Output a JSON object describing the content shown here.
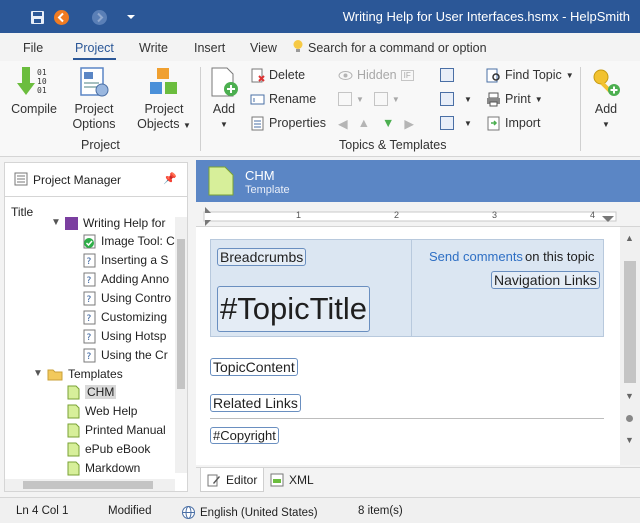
{
  "window": {
    "title": "Writing Help for User Interfaces.hsmx - HelpSmith"
  },
  "ribbon_tabs": [
    "File",
    "Project",
    "Write",
    "Insert",
    "View"
  ],
  "search": {
    "placeholder": "Search for a command or option"
  },
  "ribbon": {
    "project_group": {
      "label": "Project",
      "compile": "Compile",
      "project_options": [
        "Project",
        "Options"
      ],
      "project_objects": [
        "Project",
        "Objects"
      ]
    },
    "topics_group": {
      "label": "Topics & Templates",
      "add": "Add",
      "delete": "Delete",
      "rename": "Rename",
      "properties": "Properties",
      "hidden": "Hidden",
      "find_topic": "Find Topic",
      "print": "Print",
      "import": "Import"
    },
    "add2": "Add"
  },
  "project_manager": {
    "title": "Project Manager",
    "column": "Title",
    "topics": [
      "Writing Help for",
      "Image Tool: C",
      "Inserting a S",
      "Adding Anno",
      "Using Contro",
      "Customizing",
      "Using Hotsp",
      "Using the Cr"
    ],
    "templates_folder": "Templates",
    "templates": [
      "CHM",
      "Web Help",
      "Printed Manual",
      "ePub eBook",
      "Markdown"
    ]
  },
  "document": {
    "name": "CHM",
    "kind": "Template",
    "ruler_marks": [
      "1",
      "2",
      "3",
      "4"
    ],
    "breadcrumbs": "Breadcrumbs",
    "send_comments": "Send comments",
    "on_topic": "on this topic",
    "navigation_links": "Navigation Links",
    "topic_title": "#TopicTitle",
    "topic_content": "TopicContent",
    "related_links": "Related Links",
    "copyright": "#Copyright"
  },
  "editor_tabs": [
    "Editor",
    "XML"
  ],
  "status": {
    "position": "Ln 4 Col 1",
    "state": "Modified",
    "language": "English (United States)",
    "items": "8 item(s)"
  },
  "colors": {
    "title_bar": "#2b5797",
    "doc_header": "#5b86c5",
    "header_area": "#dbe6f2",
    "link": "#2e6fc4"
  }
}
